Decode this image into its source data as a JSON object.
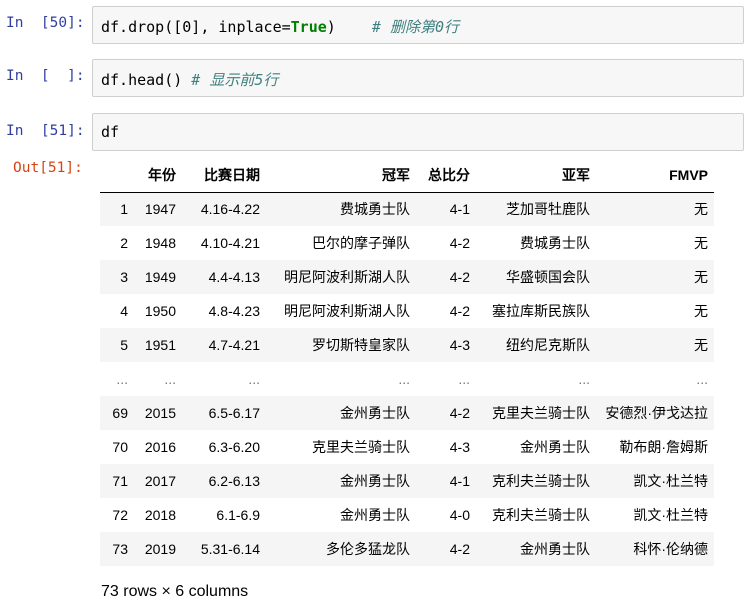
{
  "cells": [
    {
      "prompt": "In  [50]:",
      "code_parts": [
        "df.drop([0], inplace=",
        "True",
        ")",
        "    # 删除第0行"
      ]
    },
    {
      "prompt": "In  [  ]:",
      "code_parts": [
        "df.head()",
        " # 显示前5行"
      ]
    },
    {
      "prompt": "In  [51]:",
      "code_parts": [
        "df"
      ]
    }
  ],
  "output": {
    "prompt": "Out[51]:",
    "columns": [
      "",
      "年份",
      "比赛日期",
      "冠军",
      "总比分",
      "亚军",
      "FMVP"
    ],
    "rows": [
      [
        "1",
        "1947",
        "4.16-4.22",
        "费城勇士队",
        "4-1",
        "芝加哥牡鹿队",
        "无"
      ],
      [
        "2",
        "1948",
        "4.10-4.21",
        "巴尔的摩子弹队",
        "4-2",
        "费城勇士队",
        "无"
      ],
      [
        "3",
        "1949",
        "4.4-4.13",
        "明尼阿波利斯湖人队",
        "4-2",
        "华盛顿国会队",
        "无"
      ],
      [
        "4",
        "1950",
        "4.8-4.23",
        "明尼阿波利斯湖人队",
        "4-2",
        "塞拉库斯民族队",
        "无"
      ],
      [
        "5",
        "1951",
        "4.7-4.21",
        "罗切斯特皇家队",
        "4-3",
        "纽约尼克斯队",
        "无"
      ],
      [
        "...",
        "...",
        "...",
        "...",
        "...",
        "...",
        "..."
      ],
      [
        "69",
        "2015",
        "6.5-6.17",
        "金州勇士队",
        "4-2",
        "克里夫兰骑士队",
        "安德烈·伊戈达拉"
      ],
      [
        "70",
        "2016",
        "6.3-6.20",
        "克里夫兰骑士队",
        "4-3",
        "金州勇士队",
        "勒布朗·詹姆斯"
      ],
      [
        "71",
        "2017",
        "6.2-6.13",
        "金州勇士队",
        "4-1",
        "克利夫兰骑士队",
        "凯文·杜兰特"
      ],
      [
        "72",
        "2018",
        "6.1-6.9",
        "金州勇士队",
        "4-0",
        "克利夫兰骑士队",
        "凯文·杜兰特"
      ],
      [
        "73",
        "2019",
        "5.31-6.14",
        "多伦多猛龙队",
        "4-2",
        "金州勇士队",
        "科怀·伦纳德"
      ]
    ],
    "summary": "73 rows × 6 columns"
  }
}
